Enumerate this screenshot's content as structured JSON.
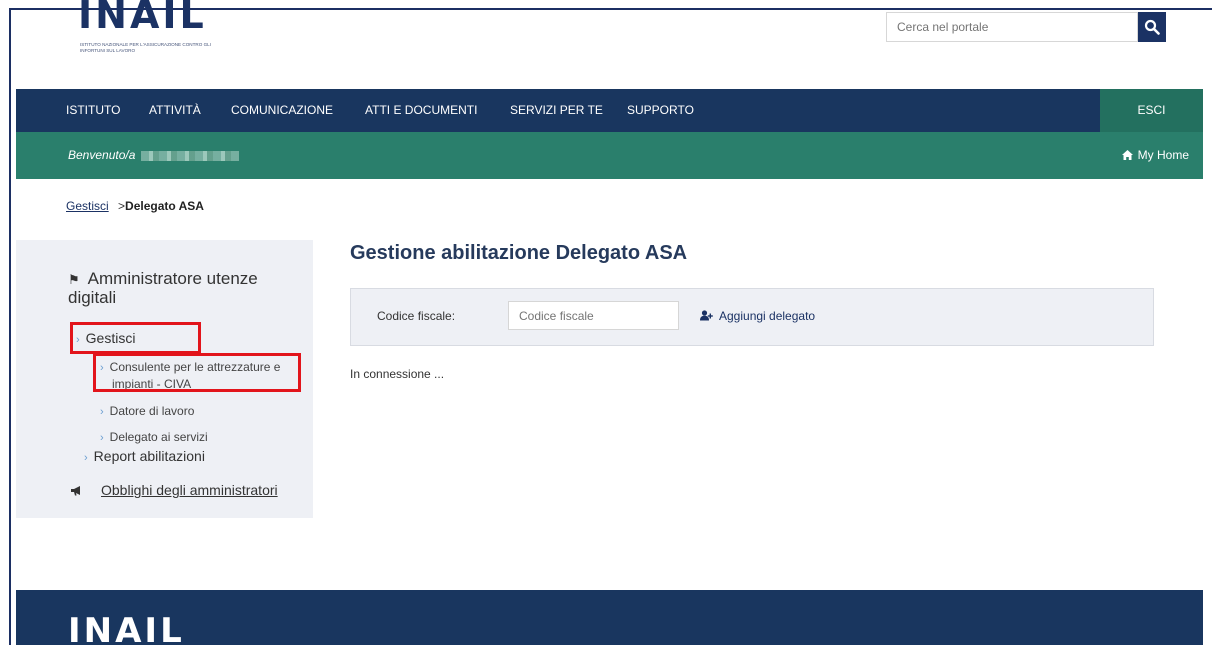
{
  "brand": {
    "logo_text": "INAIL",
    "logo_subtitle": "ISTITUTO NAZIONALE PER L'ASSICURAZIONE CONTRO GLI INFORTUNI SUL LAVORO"
  },
  "search": {
    "placeholder": "Cerca nel portale",
    "icon": "search-icon"
  },
  "nav": {
    "items": [
      "ISTITUTO",
      "ATTIVITÀ",
      "COMUNICAZIONE",
      "ATTI E DOCUMENTI",
      "SERVIZI PER TE",
      "SUPPORTO"
    ],
    "logout_label": "ESCI"
  },
  "welcome": {
    "label": "Benvenuto/a",
    "home_label": "My Home",
    "home_icon": "home-icon"
  },
  "breadcrumb": {
    "parent": "Gestisci",
    "separator": ">",
    "current": "Delegato ASA"
  },
  "sidebar": {
    "title": "Amministratore utenze digitali",
    "title_icon": "flag-icon",
    "gestisci_label": "Gestisci",
    "sub_items": [
      "Consulente per le attrezzature e impianti - CIVA",
      "Datore di lavoro",
      "Delegato ai servizi"
    ],
    "report_label": "Report abilitazioni",
    "obblighi_label": "Obblighi degli amministratori",
    "obblighi_icon": "megaphone-icon",
    "highlight_color": "#e2141b"
  },
  "main": {
    "title": "Gestione abilitazione Delegato ASA",
    "codice_label": "Codice fiscale:",
    "codice_placeholder": "Codice fiscale",
    "add_label": "Aggiungi delegato",
    "add_icon": "add-user-icon",
    "status": "In connessione ..."
  },
  "colors": {
    "nav_bg": "#19365f",
    "green_bar": "#2a7f6c",
    "esci_bg": "#23705f",
    "sidebar_bg": "#eef0f5"
  },
  "footer": {
    "logo_text": "INAIL"
  }
}
